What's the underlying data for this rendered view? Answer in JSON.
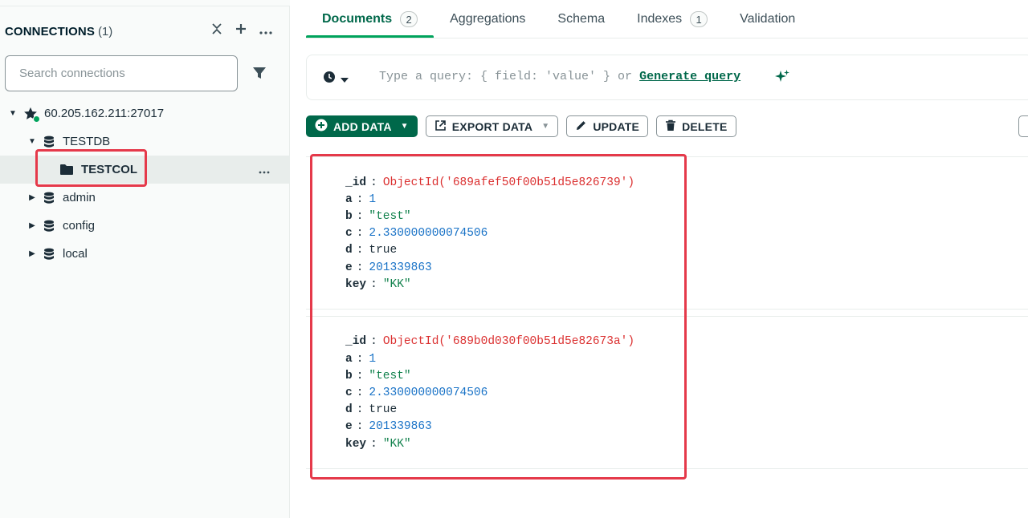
{
  "sidebar": {
    "connections_title": "CONNECTIONS",
    "connections_count": "(1)",
    "search_placeholder": "Search connections",
    "connection_host": "60.205.162.211:27017",
    "tree": [
      {
        "label": "TESTDB",
        "type": "database",
        "expanded": true
      },
      {
        "label": "TESTCOL",
        "type": "collection",
        "selected": true
      },
      {
        "label": "admin",
        "type": "database",
        "expanded": false
      },
      {
        "label": "config",
        "type": "database",
        "expanded": false
      },
      {
        "label": "local",
        "type": "database",
        "expanded": false
      }
    ]
  },
  "tabs": [
    {
      "label": "Documents",
      "badge": "2",
      "active": true
    },
    {
      "label": "Aggregations"
    },
    {
      "label": "Schema"
    },
    {
      "label": "Indexes",
      "badge": "1"
    },
    {
      "label": "Validation"
    }
  ],
  "query": {
    "placeholder": "Type a query: { field: 'value' } or",
    "generate_label": "Generate query"
  },
  "toolbar": {
    "add_data": "ADD DATA",
    "export_data": "EXPORT DATA",
    "update": "UPDATE",
    "delete": "DELETE"
  },
  "documents": [
    {
      "fields": [
        {
          "key": "_id",
          "value": "ObjectId('689afef50f00b51d5e826739')",
          "kind": "oid"
        },
        {
          "key": "a",
          "value": "1",
          "kind": "num"
        },
        {
          "key": "b",
          "value": "\"test\"",
          "kind": "str"
        },
        {
          "key": "c",
          "value": "2.330000000074506",
          "kind": "num"
        },
        {
          "key": "d",
          "value": "true",
          "kind": "bool"
        },
        {
          "key": "e",
          "value": "201339863",
          "kind": "num"
        },
        {
          "key": "key",
          "value": "\"KK\"",
          "kind": "str"
        }
      ]
    },
    {
      "fields": [
        {
          "key": "_id",
          "value": "ObjectId('689b0d030f00b51d5e82673a')",
          "kind": "oid"
        },
        {
          "key": "a",
          "value": "1",
          "kind": "num"
        },
        {
          "key": "b",
          "value": "\"test\"",
          "kind": "str"
        },
        {
          "key": "c",
          "value": "2.330000000074506",
          "kind": "num"
        },
        {
          "key": "d",
          "value": "true",
          "kind": "bool"
        },
        {
          "key": "e",
          "value": "201339863",
          "kind": "num"
        },
        {
          "key": "key",
          "value": "\"KK\"",
          "kind": "str"
        }
      ]
    }
  ],
  "colors": {
    "accent_green": "#00684a",
    "highlight_red": "#e5394a",
    "online_dot": "#00a35c"
  }
}
